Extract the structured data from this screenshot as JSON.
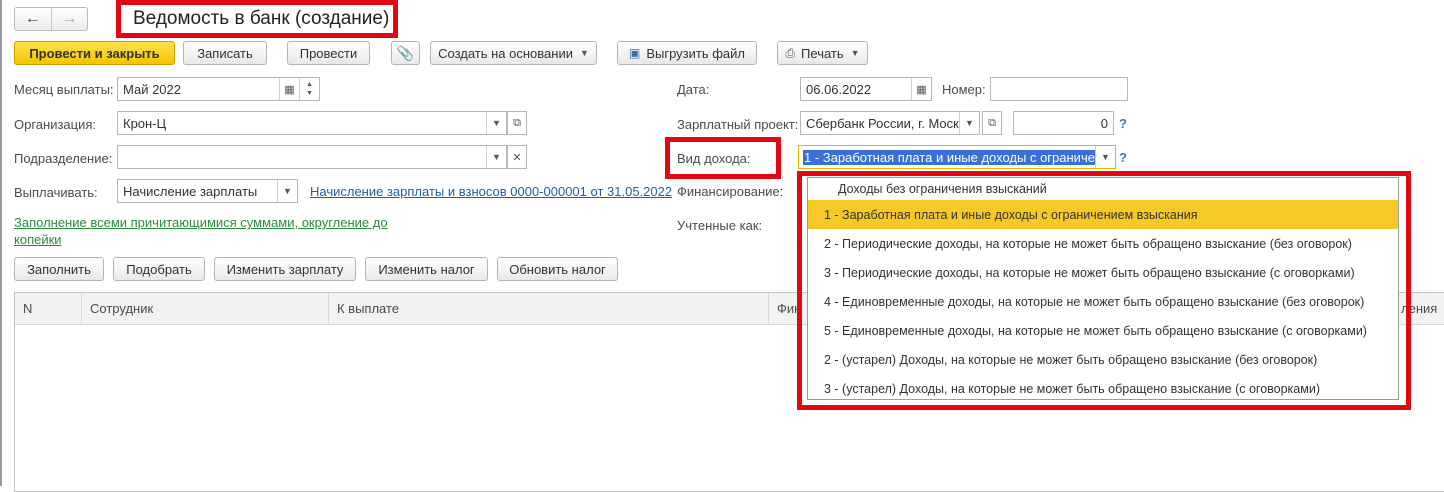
{
  "window": {
    "title": "Ведомость в банк (создание)"
  },
  "nav": {
    "back": "←",
    "forward": "→"
  },
  "toolbar": {
    "post_close": "Провести и закрыть",
    "save": "Записать",
    "post": "Провести",
    "create_based_on": "Создать на основании",
    "export_file": "Выгрузить файл",
    "print": "Печать"
  },
  "form": {
    "month_label": "Месяц выплаты:",
    "month_value": "Май 2022",
    "org_label": "Организация:",
    "org_value": "Крон-Ц",
    "dept_label": "Подразделение:",
    "dept_value": "",
    "pay_label": "Выплачивать:",
    "pay_value": "Начисление зарплаты",
    "pay_link": "Начисление зарплаты и взносов 0000-000001 от 31.05.2022",
    "fill_note": "Заполнение всеми причитающимися суммами, округление до копейки",
    "date_label": "Дата:",
    "date_value": "06.06.2022",
    "number_label": "Номер:",
    "number_value": "",
    "project_label": "Зарплатный проект:",
    "project_value": "Сбербанк России, г. Моск",
    "project_count": "0",
    "income_label": "Вид дохода:",
    "income_value": "1 - Заработная плата и иные доходы с ограниче",
    "financing_label": "Финансирование:",
    "accounted_label": "Учтенные как:",
    "help": "?"
  },
  "actions": {
    "fill": "Заполнить",
    "select": "Подобрать",
    "change_salary": "Изменить зарплату",
    "change_tax": "Изменить налог",
    "update_tax": "Обновить налог"
  },
  "table": {
    "columns": [
      "N",
      "Сотрудник",
      "К выплате",
      "Фин",
      "ления"
    ]
  },
  "dropdown": {
    "options": [
      "Доходы без ограничения взысканий",
      "1 - Заработная плата и иные доходы с ограничением взыскания",
      "2 - Периодические доходы, на которые не может быть обращено взыскание (без оговорок)",
      "3 - Периодические доходы, на которые не может быть обращено взыскание (с оговорками)",
      "4 - Единовременные доходы, на которые не может быть обращено взыскание (без оговорок)",
      "5 - Единовременные доходы, на которые не может быть обращено взыскание (с оговорками)",
      "2 - (устарел) Доходы, на которые не может быть обращено взыскание (без оговорок)",
      "3 - (устарел) Доходы, на которые не может быть обращено взыскание (с оговорками)"
    ],
    "selected_index": 1
  },
  "colors": {
    "highlight": "#e30613",
    "primary": "#f5c400",
    "selected_option": "#f6c926",
    "link": "#1f5ea8",
    "green_link": "#2b8a3e"
  }
}
